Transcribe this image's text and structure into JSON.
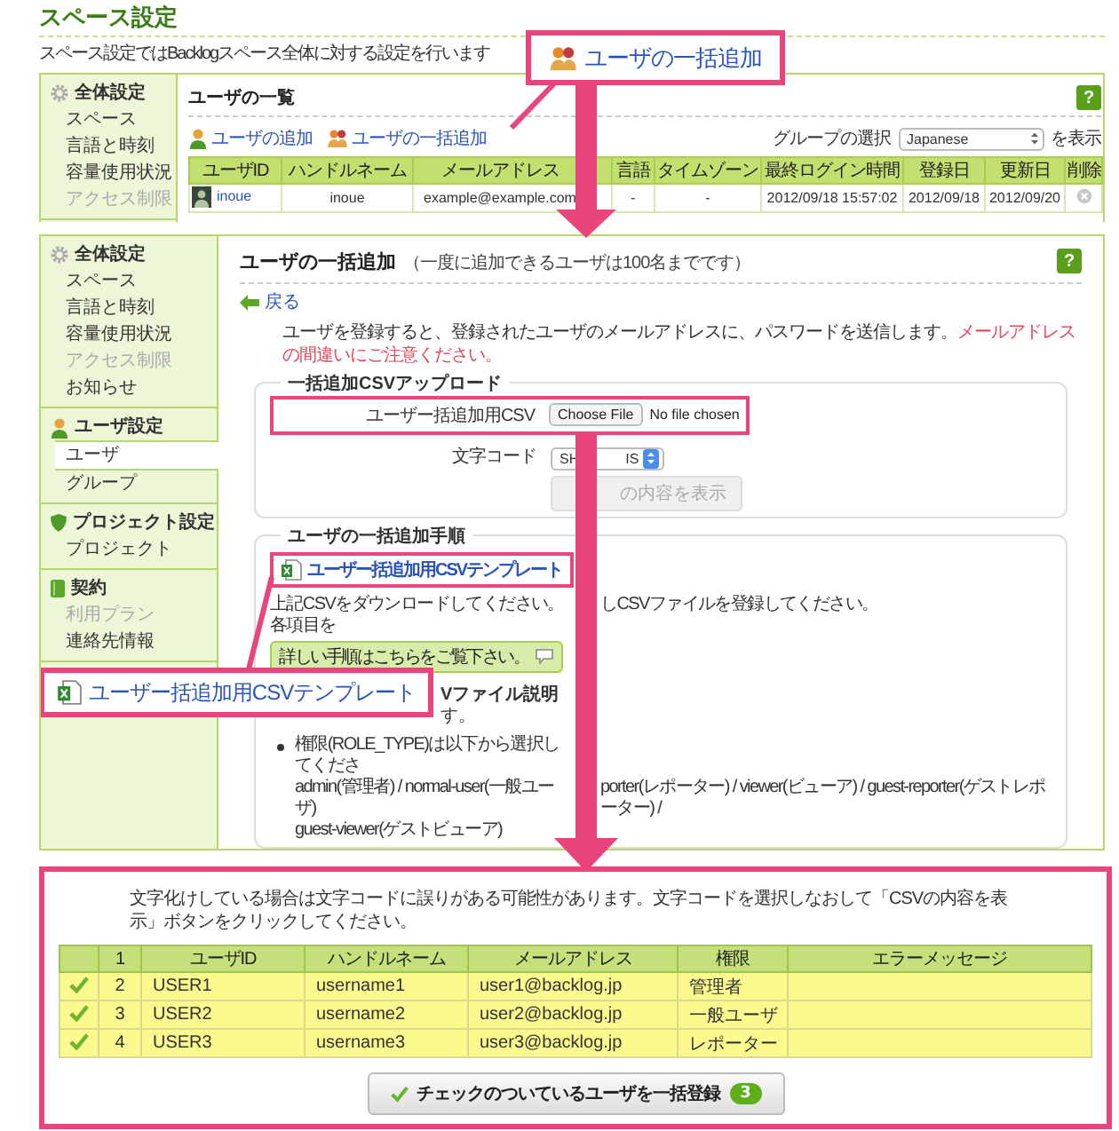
{
  "page": {
    "title": "スペース設定",
    "description": "スペース設定ではBacklogスペース全体に対する設定を行います"
  },
  "callouts": [
    {
      "kind": "users",
      "text": "ユーザの一括追加"
    },
    {
      "kind": "spreadsheet",
      "text": "ユーザー括追加用CSVテンプレート"
    }
  ],
  "user_list": {
    "sidebar": [
      {
        "kind": "general",
        "heading": "全体設定",
        "items": [
          {
            "label": "スペース",
            "selected": false,
            "disabled": false
          },
          {
            "label": "言語と時刻",
            "selected": false,
            "disabled": false
          },
          {
            "label": "容量使用状況",
            "selected": false,
            "disabled": false
          },
          {
            "label": "アクセス制限",
            "selected": false,
            "disabled": true
          }
        ]
      }
    ],
    "title": "ユーザの一覧",
    "help": "?",
    "actions": [
      {
        "kind": "user",
        "label": "ユーザの追加"
      },
      {
        "kind": "users",
        "label": "ユーザの一括追加"
      }
    ],
    "group_filter": {
      "label": "グループの選択",
      "value": "Japanese",
      "suffix": "を表示"
    },
    "table": {
      "columns": [
        {
          "kind": "text",
          "label": "ユーザID"
        },
        {
          "kind": "text",
          "label": "ハンドルネーム"
        },
        {
          "kind": "text",
          "label": "メールアドレス"
        },
        {
          "kind": "covered"
        },
        {
          "kind": "text",
          "label": "言語"
        },
        {
          "kind": "text",
          "label": "タイムゾーン"
        },
        {
          "kind": "text",
          "label": "最終ログイン時間"
        },
        {
          "kind": "text",
          "label": "登録日"
        },
        {
          "kind": "text",
          "label": "更新日"
        },
        {
          "kind": "text",
          "label": "削除"
        }
      ],
      "rows": [
        {
          "cells": [
            {
              "kind": "user",
              "text": "inoue"
            },
            {
              "kind": "text",
              "text": "inoue"
            },
            {
              "kind": "text",
              "text": "example@example.com"
            },
            {
              "kind": "covered"
            },
            {
              "kind": "text",
              "text": "-"
            },
            {
              "kind": "text",
              "text": "-"
            },
            {
              "kind": "text",
              "text": "2012/09/18 15:57:02"
            },
            {
              "kind": "text",
              "text": "2012/09/18"
            },
            {
              "kind": "text",
              "text": "2012/09/20"
            },
            {
              "kind": "delete"
            }
          ]
        }
      ]
    }
  },
  "bulk_add": {
    "sidebar": [
      {
        "kind": "general",
        "heading": "全体設定",
        "items": [
          {
            "label": "スペース",
            "selected": false,
            "disabled": false
          },
          {
            "label": "言語と時刻",
            "selected": false,
            "disabled": false
          },
          {
            "label": "容量使用状況",
            "selected": false,
            "disabled": false
          },
          {
            "label": "アクセス制限",
            "selected": false,
            "disabled": true
          },
          {
            "label": "お知らせ",
            "selected": false,
            "disabled": false
          }
        ]
      },
      {
        "kind": "user",
        "heading": "ユーザ設定",
        "items": [
          {
            "label": "ユーザ",
            "selected": true,
            "disabled": false
          },
          {
            "label": "グループ",
            "selected": false,
            "disabled": false
          }
        ]
      },
      {
        "kind": "project",
        "heading": "プロジェクト設定",
        "items": [
          {
            "label": "プロジェクト",
            "selected": false,
            "disabled": false
          }
        ]
      },
      {
        "kind": "contract",
        "heading": "契約",
        "items": [
          {
            "label": "利用プラン",
            "selected": false,
            "disabled": true
          },
          {
            "label": "連絡先情報",
            "selected": false,
            "disabled": false
          }
        ]
      }
    ],
    "title": "ユーザの一括追加",
    "note": "（一度に追加できるユーザは100名までです）",
    "help": "?",
    "back": "戻る",
    "intro": "ユーザを登録すると、登録されたユーザのメールアドレスに、パスワードを送信します。",
    "warning": "メールアドレスの間違いにご注意ください。",
    "upload": {
      "legend": "一括追加CSVアップロード",
      "file_label": "ユーザー括追加用CSV",
      "file_button": "Choose File",
      "file_status": "No file chosen",
      "encoding_label": "文字コード",
      "encoding_visible": [
        "SH",
        "IS"
      ],
      "submit_visible": "の内容を表示",
      "submit_disabled": true
    },
    "steps": {
      "legend": "ユーザの一括追加手順",
      "template_link": "ユーザー括追加用CSVテンプレート",
      "download_note": {
        "left": "上記CSVをダウンロードしてください。各項目を",
        "right": "しCSVファイルを登録してください。"
      },
      "help_button": "詳しい手順はこちらをご覧下さい。",
      "spec_heading": "Vファイル説明",
      "spec_note": "す。",
      "bullet_lines": [
        {
          "left": "権限(ROLE_TYPE)は以下から選択してくださ"
        },
        {
          "left": "admin(管理者) / normal-user(一般ユーザ)",
          "right": "porter(レポーター) / viewer(ビューア) / guest-reporter(ゲストレポーター) /"
        },
        {
          "left": "guest-viewer(ゲストビューア)"
        }
      ]
    }
  },
  "preview": {
    "note": "文字化けしている場合は文字コードに誤りがある可能性があります。文字コードを選択しなおして「CSVの内容を表示」ボタンをクリックしてください。",
    "columns": [
      {
        "kind": "check"
      },
      {
        "kind": "text",
        "label": "1"
      },
      {
        "kind": "text",
        "label": "ユーザID"
      },
      {
        "kind": "text",
        "label": "ハンドルネーム"
      },
      {
        "kind": "text",
        "label": "メールアドレス"
      },
      {
        "kind": "text",
        "label": "権限"
      },
      {
        "kind": "text",
        "label": "エラーメッセージ"
      }
    ],
    "rows": [
      {
        "cells": [
          {
            "kind": "check",
            "checked": true
          },
          {
            "kind": "text",
            "text": "2"
          },
          {
            "kind": "text",
            "text": "USER1"
          },
          {
            "kind": "text",
            "text": "username1"
          },
          {
            "kind": "text",
            "text": "user1@backlog.jp"
          },
          {
            "kind": "text",
            "text": "管理者"
          }
        ]
      },
      {
        "cells": [
          {
            "kind": "check",
            "checked": true
          },
          {
            "kind": "text",
            "text": "3"
          },
          {
            "kind": "text",
            "text": "USER2"
          },
          {
            "kind": "text",
            "text": "username2"
          },
          {
            "kind": "text",
            "text": "user2@backlog.jp"
          },
          {
            "kind": "text",
            "text": "一般ユーザ"
          }
        ]
      },
      {
        "cells": [
          {
            "kind": "check",
            "checked": true
          },
          {
            "kind": "text",
            "text": "4"
          },
          {
            "kind": "text",
            "text": "USER3"
          },
          {
            "kind": "text",
            "text": "username3"
          },
          {
            "kind": "text",
            "text": "user3@backlog.jp"
          },
          {
            "kind": "text",
            "text": "レポーター"
          }
        ]
      }
    ],
    "submit": {
      "label": "チェックのついているユーザを一括登録",
      "count": "3"
    }
  }
}
